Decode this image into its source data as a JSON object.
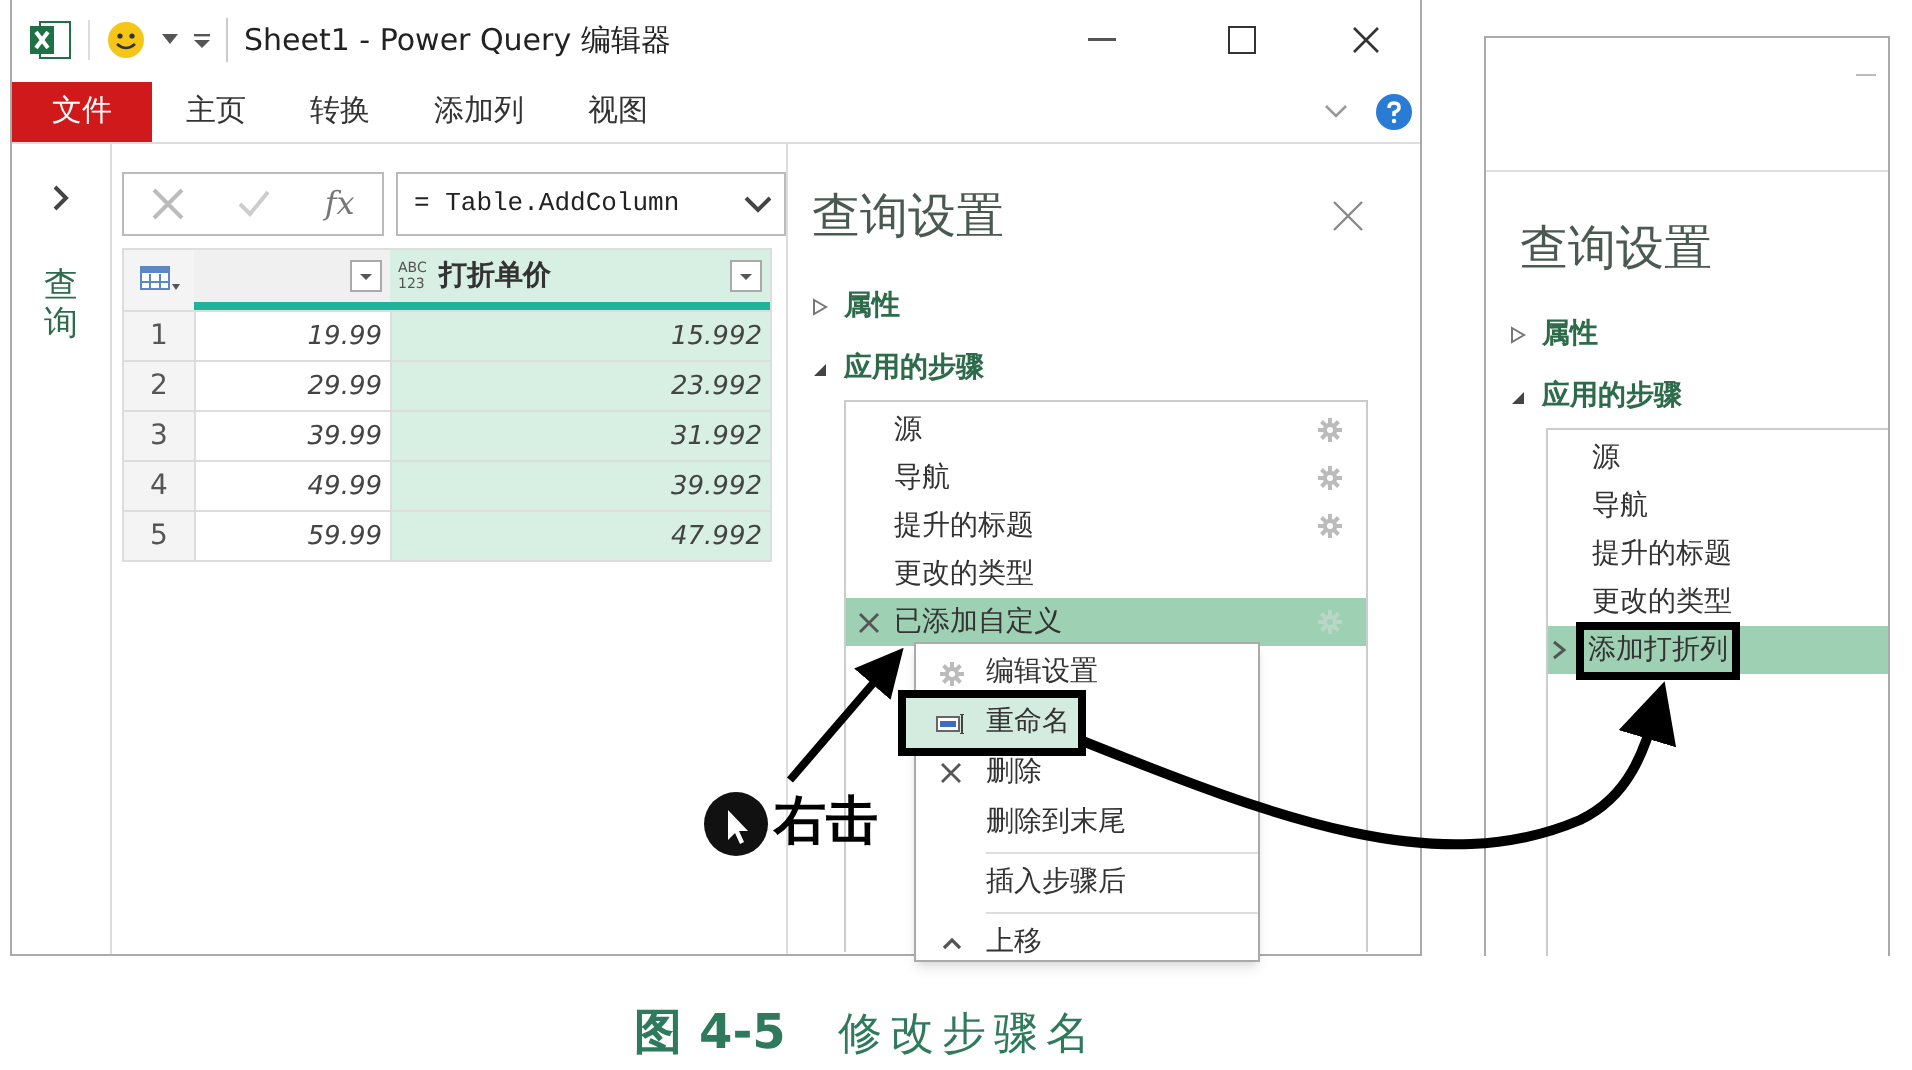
{
  "window": {
    "title": "Sheet1 - Power Query 编辑器"
  },
  "ribbon_tabs": [
    {
      "label": "文件",
      "kind": "file",
      "selected": false
    },
    {
      "label": "主页",
      "kind": "tab",
      "selected": false
    },
    {
      "label": "转换",
      "kind": "tab",
      "selected": false
    },
    {
      "label": "添加列",
      "kind": "tab",
      "selected": false
    },
    {
      "label": "视图",
      "kind": "tab",
      "selected": false
    }
  ],
  "nav_pane": {
    "label": "查询",
    "expanded": false
  },
  "formula_bar": {
    "function_label": "fx",
    "value": "= Table.AddColumn"
  },
  "table": {
    "columns": [
      {
        "selected": false
      },
      {
        "type_label": [
          "ABC",
          "123"
        ],
        "label": "打折单价",
        "selected": true
      }
    ],
    "rows": [
      [
        "1",
        "19.99",
        "15.992"
      ],
      [
        "2",
        "29.99",
        "23.992"
      ],
      [
        "3",
        "39.99",
        "31.992"
      ],
      [
        "4",
        "49.99",
        "39.992"
      ],
      [
        "5",
        "59.99",
        "47.992"
      ]
    ]
  },
  "query_settings": {
    "title": "查询设置",
    "sections": [
      {
        "label": "属性",
        "expanded": false
      },
      {
        "label": "应用的步骤",
        "expanded": true
      }
    ],
    "steps": [
      {
        "label": "源",
        "gear": true,
        "selected": false
      },
      {
        "label": "导航",
        "gear": true,
        "selected": false
      },
      {
        "label": "提升的标题",
        "gear": true,
        "selected": false
      },
      {
        "label": "更改的类型",
        "gear": false,
        "selected": false
      },
      {
        "label": "已添加自定义",
        "gear": true,
        "selected": true
      }
    ]
  },
  "context_menu": [
    {
      "label": "编辑设置",
      "kind": "settings",
      "highlighted": false,
      "callout": false
    },
    {
      "label": "重命名",
      "kind": "rename",
      "highlighted": true,
      "callout": true
    },
    {
      "label": "删除",
      "kind": "delete",
      "highlighted": false,
      "callout": false
    },
    {
      "label": "删除到末尾",
      "kind": "plain",
      "highlighted": false,
      "callout": false
    },
    {
      "label": "插入步骤后",
      "kind": "plain",
      "highlighted": false,
      "callout": false
    },
    {
      "label": "上移",
      "kind": "move",
      "highlighted": false,
      "callout": false
    }
  ],
  "annotation": {
    "label": "右击"
  },
  "result_panel": {
    "title": "查询设置",
    "sections": [
      {
        "label": "属性",
        "expanded": false
      },
      {
        "label": "应用的步骤",
        "expanded": true
      }
    ],
    "steps": [
      {
        "label": "源",
        "selected": false,
        "callout": false
      },
      {
        "label": "导航",
        "selected": false,
        "callout": false
      },
      {
        "label": "提升的标题",
        "selected": false,
        "callout": false
      },
      {
        "label": "更改的类型",
        "selected": false,
        "callout": false
      },
      {
        "label": "添加打折列",
        "selected": true,
        "callout": true
      }
    ]
  },
  "caption": {
    "number": "图 4-5",
    "text": "修改步骤名"
  }
}
